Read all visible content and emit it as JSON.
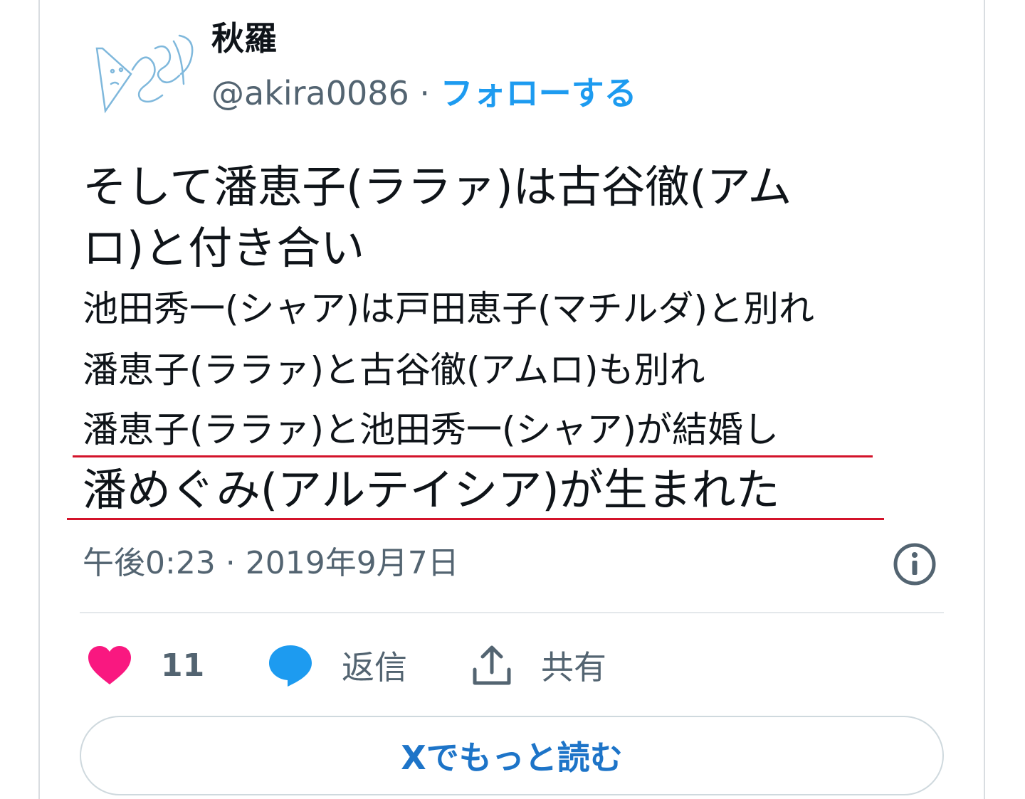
{
  "author": {
    "display_name": "秋羅",
    "handle": "@akira0086",
    "separator": " · ",
    "follow_label": "フォローする",
    "avatar_icon": "signature-avatar-icon"
  },
  "tweet": {
    "lines": [
      "そして潘恵子(ララァ)は古谷徹(アム",
      "ロ)と付き合い",
      "池田秀一(シャア)は戸田恵子(マチルダ)と別れ",
      "潘恵子(ララァ)と古谷徹(アムロ)も別れ",
      "潘恵子(ララァ)と池田秀一(シャア)が結婚し",
      "潘めぐみ(アルテイシア)が生まれた"
    ],
    "timestamp": "午後0:23 · 2019年9月7日"
  },
  "actions": {
    "like_count": "11",
    "reply_label": "返信",
    "share_label": "共有"
  },
  "read_more_label": "Xでもっと読む",
  "colors": {
    "accent": "#1d9bf0",
    "like": "#f91880",
    "reply_icon": "#1d9bf0",
    "underline": "#d3132a",
    "secondary_text": "#536471"
  },
  "icons": {
    "info": "info-icon",
    "like": "heart-icon",
    "reply": "speech-bubble-icon",
    "share": "share-upload-icon"
  }
}
